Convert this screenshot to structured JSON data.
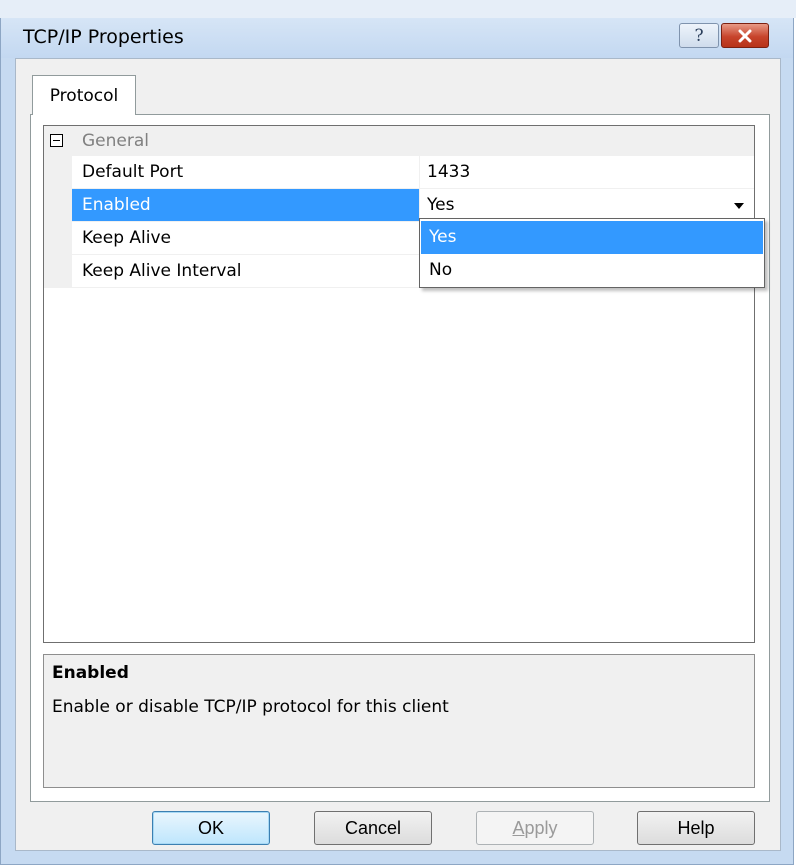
{
  "window": {
    "title": "TCP/IP Properties",
    "help_glyph": "?",
    "close_glyph": "✕"
  },
  "tabs": [
    {
      "label": "Protocol",
      "active": true
    }
  ],
  "property_grid": {
    "category": {
      "label": "General",
      "expander": "−"
    },
    "properties": [
      {
        "name": "Default Port",
        "value": "1433"
      },
      {
        "name": "Enabled",
        "value": "Yes",
        "selected": true
      },
      {
        "name": "Keep Alive",
        "value": ""
      },
      {
        "name": "Keep Alive Interval",
        "value": ""
      }
    ],
    "dropdown": {
      "options": [
        "Yes",
        "No"
      ],
      "highlighted": "Yes"
    }
  },
  "description": {
    "title": "Enabled",
    "text": "Enable or disable TCP/IP protocol for this client"
  },
  "buttons": {
    "ok": "OK",
    "cancel": "Cancel",
    "apply_accel": "A",
    "apply_rest": "pply",
    "help": "Help"
  },
  "colors": {
    "selection": "#3399ff",
    "window_frame": "#c6daf1",
    "close_button": "#c7442c"
  }
}
